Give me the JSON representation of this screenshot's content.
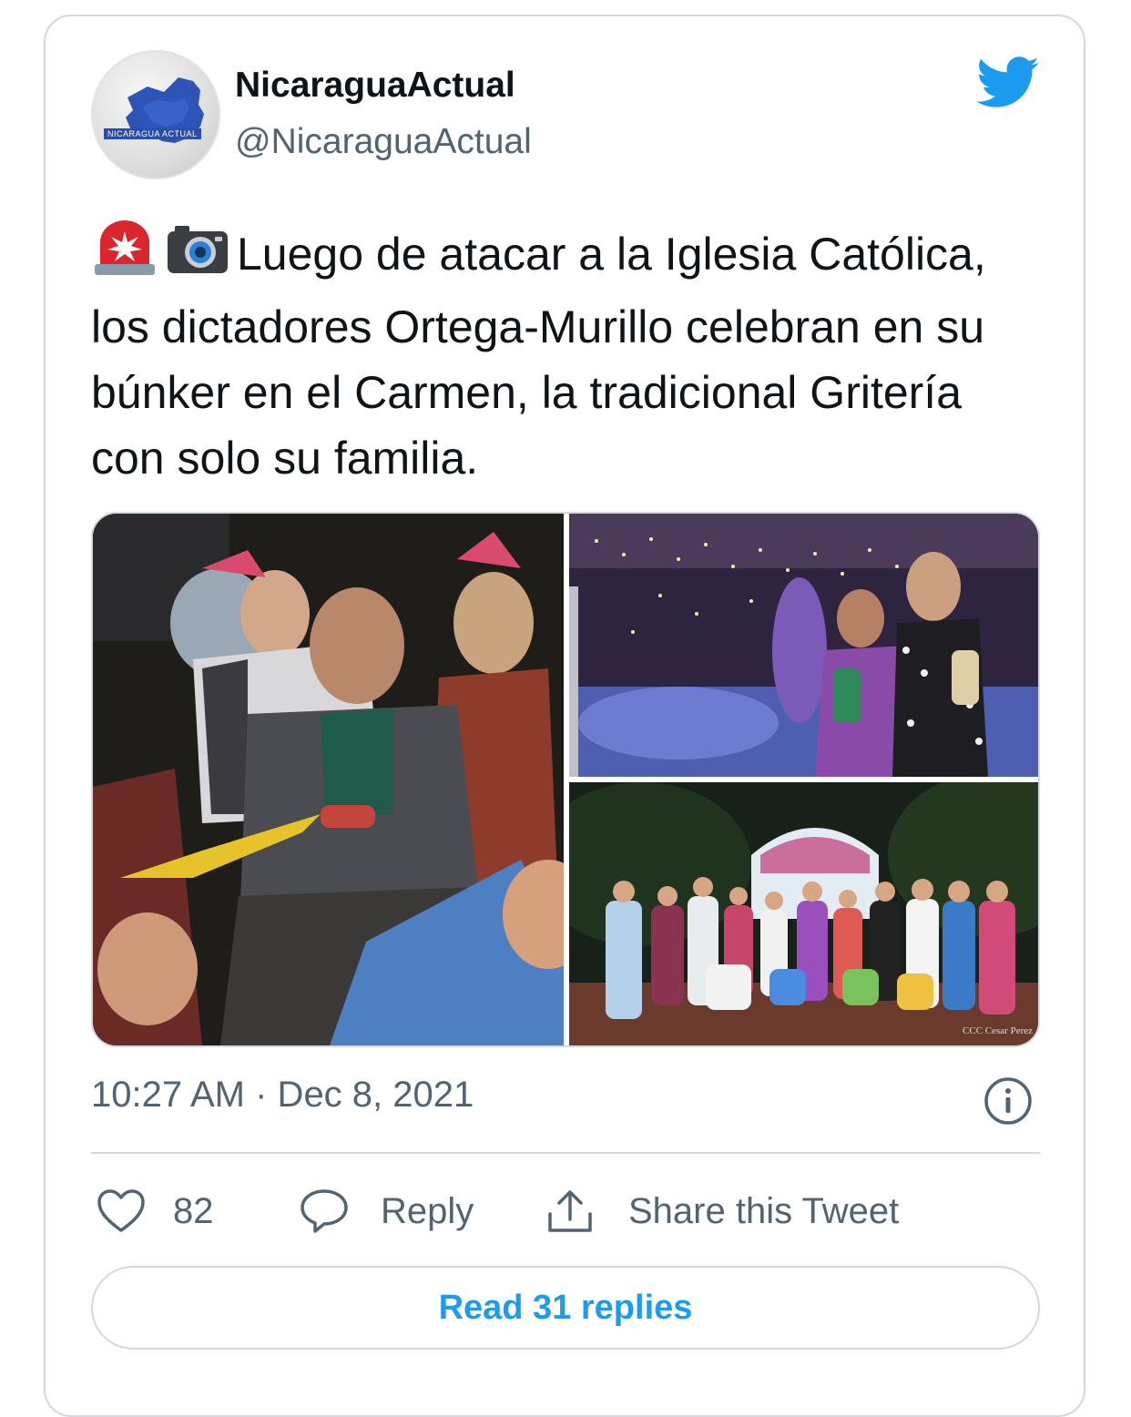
{
  "tweet": {
    "author_name": "NicaraguaActual",
    "author_handle": "@NicaraguaActual",
    "avatar_logo_text": "NICARAGUA ACTUAL",
    "text": "Luego de atacar a la Iglesia Católica, los dictadores Ortega-Murillo celebran en su búnker en el Carmen, la tradicional Gritería con solo su familia.",
    "emojis": [
      "rotating-light-emoji",
      "camera-emoji"
    ],
    "timestamp": "10:27 AM · Dec 8, 2021",
    "photo_credit": "CCC Cesar Perez",
    "photo_count": 3
  },
  "actions": {
    "like_count": "82",
    "reply_label": "Reply",
    "share_label": "Share this Tweet"
  },
  "footer": {
    "read_replies_label": "Read 31 replies"
  },
  "colors": {
    "accent": "#1d9bf0",
    "text_primary": "#0f1419",
    "text_secondary": "#536471",
    "border": "#cfd9de"
  }
}
